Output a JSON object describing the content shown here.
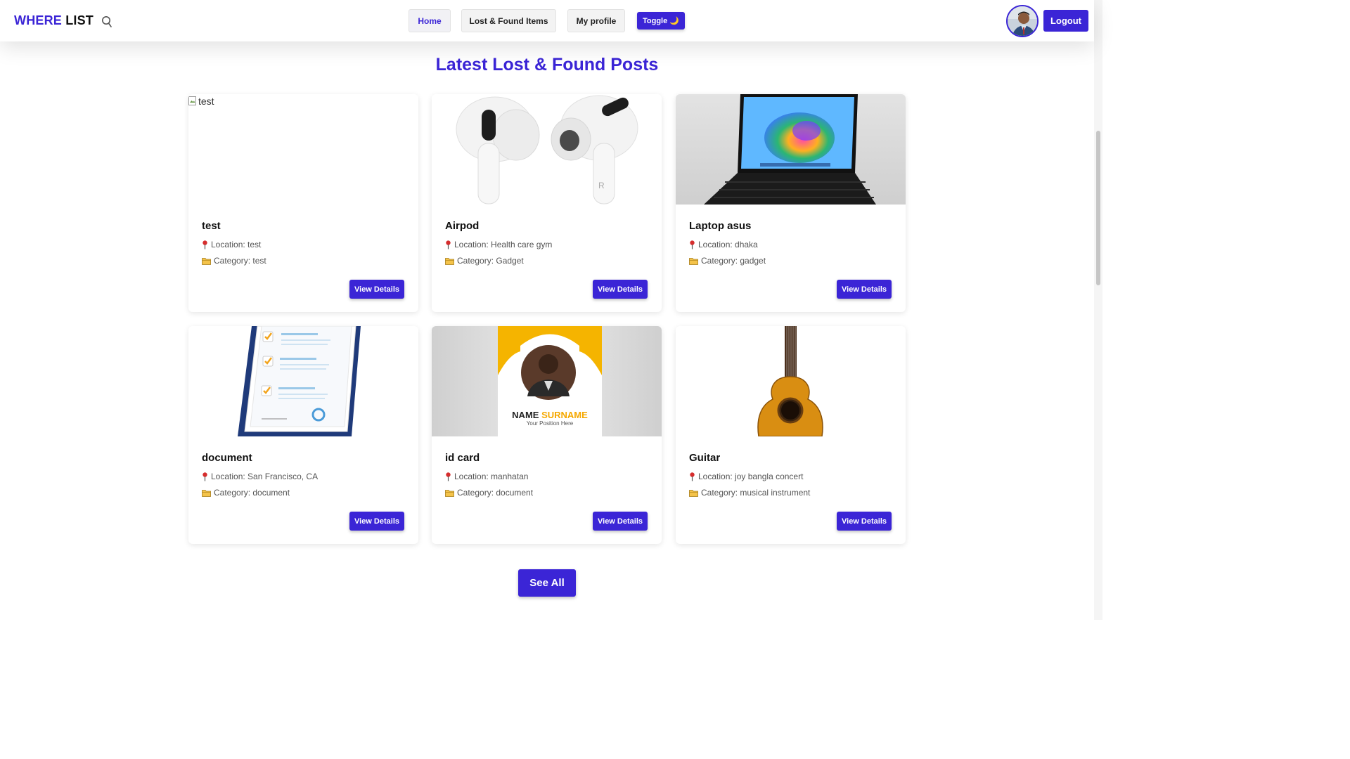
{
  "navbar": {
    "brand_part1": "WHERE",
    "brand_part2": "LIST",
    "links": [
      "Home",
      "Lost & Found Items",
      "My profile"
    ],
    "toggle_label": "Toggle 🌙",
    "logout_label": "Logout"
  },
  "page": {
    "title": "Latest Lost & Found Posts",
    "see_all_label": "See All"
  },
  "posts": [
    {
      "title": "test",
      "location": "Location: test",
      "category": "Category: test",
      "image": "broken-image",
      "image_alt": "test",
      "button": "View Details"
    },
    {
      "title": "Airpod",
      "location": "Location: Health care gym",
      "category": "Category: Gadget",
      "image": "airpods-image",
      "button": "View Details"
    },
    {
      "title": "Laptop asus",
      "location": "Location: dhaka",
      "category": "Category: gadget",
      "image": "laptop-image",
      "button": "View Details"
    },
    {
      "title": "document",
      "location": "Location: San Francisco, CA",
      "category": "Category: document",
      "image": "clipboard-document-image",
      "button": "View Details"
    },
    {
      "title": "id card",
      "location": "Location: manhatan",
      "category": "Category: document",
      "image": "id-card-image",
      "id_card_name_first": "NAME",
      "id_card_name_last": "SURNAME",
      "id_card_position": "Your Position Here",
      "button": "View Details"
    },
    {
      "title": "Guitar",
      "location": "Location: joy bangla concert",
      "category": "Category: musical instrument",
      "image": "guitar-image",
      "button": "View Details"
    }
  ],
  "colors": {
    "accent": "#3b25d6",
    "text": "#111111",
    "muted": "#555555"
  }
}
